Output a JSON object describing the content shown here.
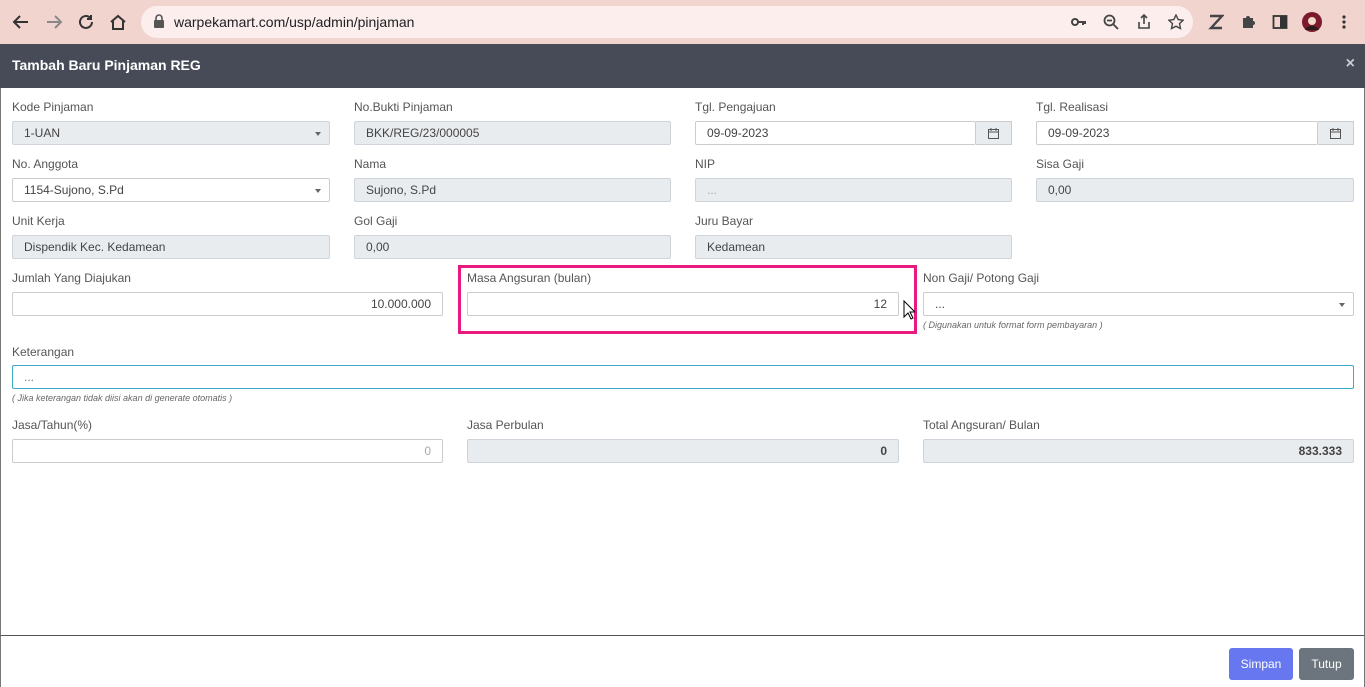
{
  "browser": {
    "url": "warpekamart.com/usp/admin/pinjaman"
  },
  "modal": {
    "title": "Tambah Baru Pinjaman REG",
    "close": "×"
  },
  "form": {
    "kode_pinjaman": {
      "label": "Kode Pinjaman",
      "value": "1-UAN"
    },
    "no_bukti": {
      "label": "No.Bukti Pinjaman",
      "value": "BKK/REG/23/000005"
    },
    "tgl_pengajuan": {
      "label": "Tgl. Pengajuan",
      "value": "09-09-2023"
    },
    "tgl_realisasi": {
      "label": "Tgl. Realisasi",
      "value": "09-09-2023"
    },
    "no_anggota": {
      "label": "No. Anggota",
      "value": "1154-Sujono, S.Pd"
    },
    "nama": {
      "label": "Nama",
      "value": "Sujono, S.Pd"
    },
    "nip": {
      "label": "NIP",
      "value": "..."
    },
    "sisa_gaji": {
      "label": "Sisa Gaji",
      "value": "0,00"
    },
    "unit_kerja": {
      "label": "Unit Kerja",
      "value": "Dispendik Kec. Kedamean"
    },
    "gol_gaji": {
      "label": "Gol Gaji",
      "value": "0,00"
    },
    "juru_bayar": {
      "label": "Juru Bayar",
      "value": "Kedamean"
    },
    "jumlah": {
      "label": "Jumlah Yang Diajukan",
      "value": "10.000.000"
    },
    "masa_angsuran": {
      "label": "Masa Angsuran (bulan)",
      "value": "12"
    },
    "non_gaji": {
      "label": "Non Gaji/ Potong Gaji",
      "value": "...",
      "hint": "( Digunakan untuk format form pembayaran )"
    },
    "keterangan": {
      "label": "Keterangan",
      "placeholder": "...",
      "hint": "( Jika keterangan tidak diisi akan di generate otomatis )"
    },
    "jasa_tahun": {
      "label": "Jasa/Tahun(%)",
      "value": "0"
    },
    "jasa_perbulan": {
      "label": "Jasa Perbulan",
      "value": "0"
    },
    "total_angsuran": {
      "label": "Total Angsuran/ Bulan",
      "value": "833.333"
    }
  },
  "footer": {
    "save_label": "Simpan",
    "close_label": "Tutup"
  },
  "colors": {
    "header": "#474b57",
    "save": "#6777ef",
    "close": "#6c757d",
    "highlight": "#e8197f"
  }
}
